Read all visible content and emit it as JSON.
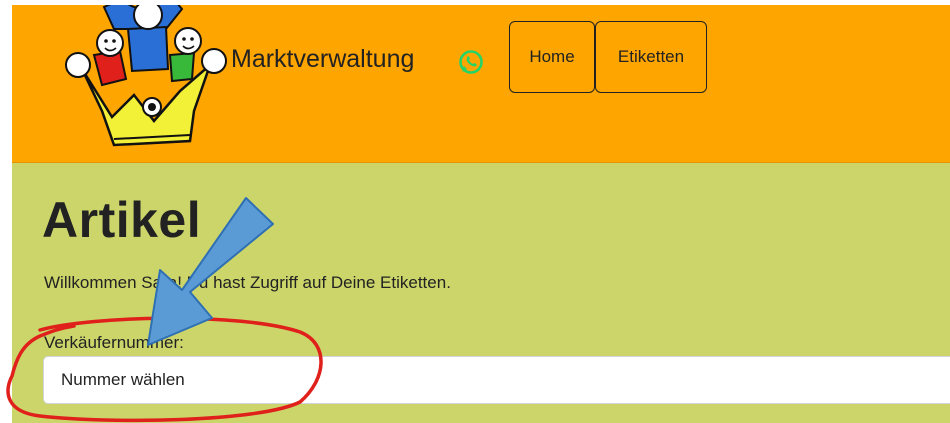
{
  "header": {
    "brand": "Marktverwaltung",
    "nav": [
      {
        "label": "Home"
      },
      {
        "label": "Etiketten"
      }
    ],
    "colors": {
      "background": "#ffa500",
      "whatsapp": "#25d366"
    },
    "icons": [
      "logo-jester-icon",
      "whatsapp-icon"
    ]
  },
  "main": {
    "title": "Artikel",
    "welcome": "Willkommen Sara! Du hast Zugriff auf Deine Etiketten.",
    "seller_label": "Verkäufernummer:",
    "seller_select": {
      "value": "Nummer wählen"
    },
    "background": "#cbd56a"
  },
  "annotations": {
    "arrow_color": "#5b9bd5",
    "circle_color": "#e0201a"
  }
}
